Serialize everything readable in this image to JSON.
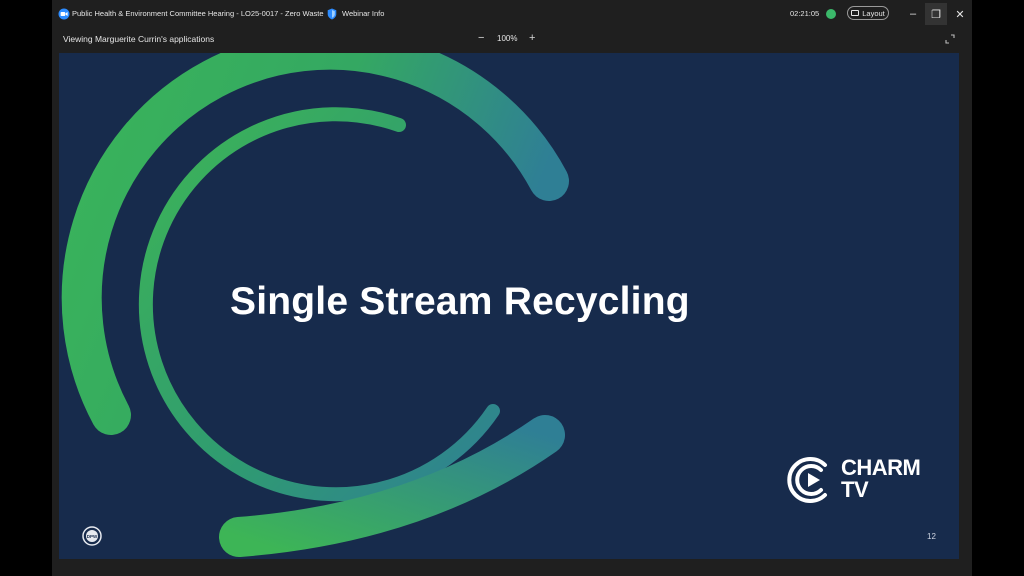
{
  "titlebar": {
    "meeting_title": "Public Health & Environment Committee Hearing - LO25-0017 - Zero Waste",
    "webinar_info": "Webinar Info",
    "timer": "02:21:05",
    "layout_label": "Layout",
    "minimize": "–",
    "restore": "❐",
    "close": "✕"
  },
  "share_bar": {
    "viewing_label": "Viewing Marguerite Currin's applications",
    "zoom_out": "−",
    "zoom_level": "100%",
    "zoom_in": "+"
  },
  "slide": {
    "title": "Single Stream Recycling",
    "slide_number": "12",
    "watermark": {
      "line1": "CHARM",
      "line2": "TV"
    },
    "org_logo_text": "DPW",
    "colors": {
      "background": "#172b4c",
      "ring_green": "#3db556",
      "ring_teal": "#2f7f95"
    }
  },
  "colors": {
    "window_bg": "#1f1f1f",
    "status_green": "#3bb86a",
    "accent_blue": "#2d8cff"
  }
}
